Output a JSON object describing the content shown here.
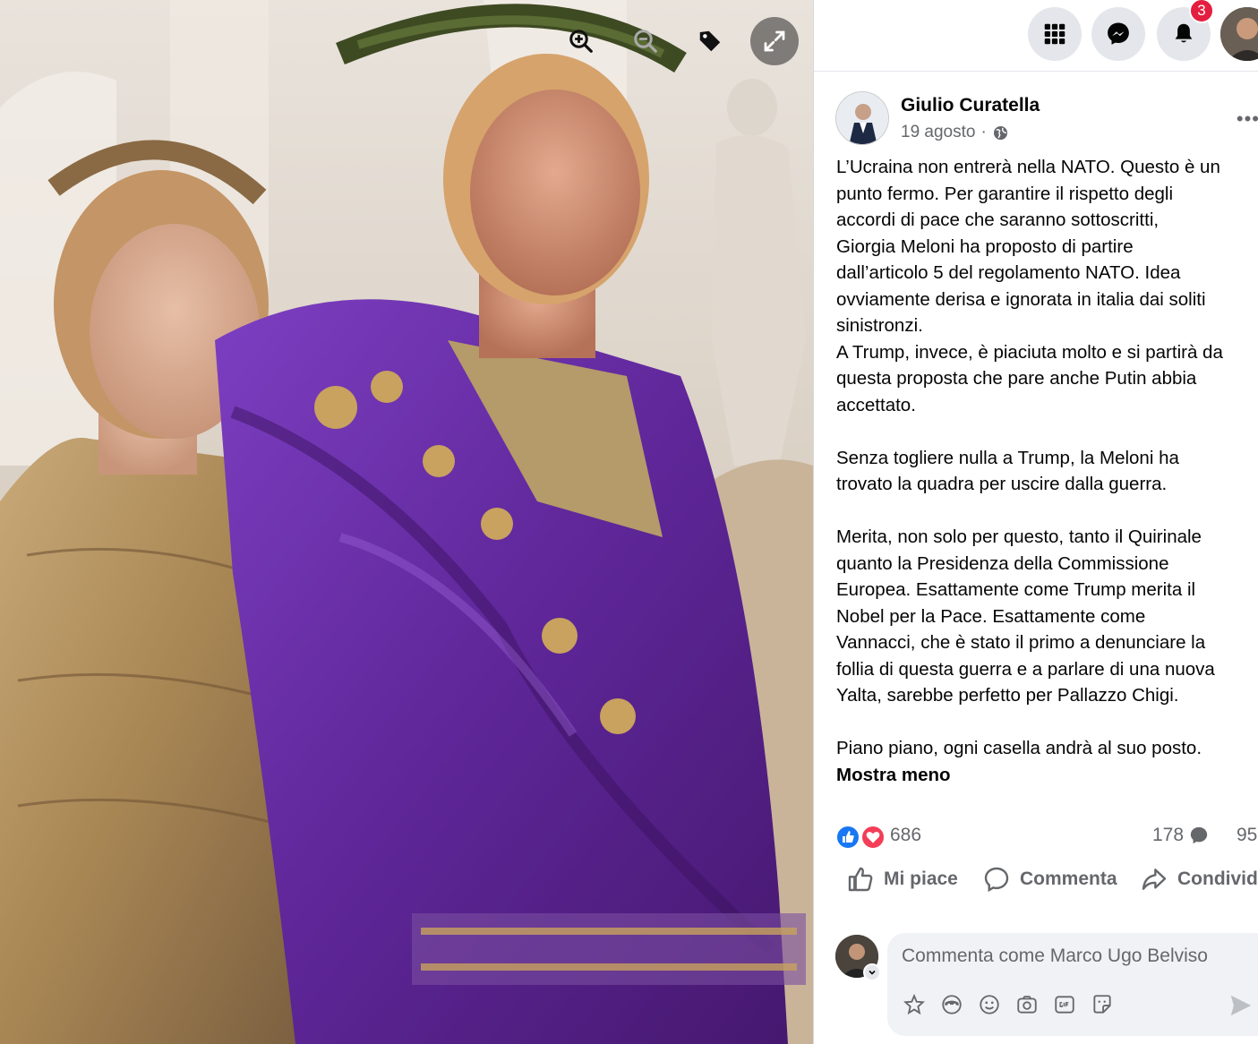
{
  "viewer": {
    "controls": [
      {
        "name": "zoom-in-icon"
      },
      {
        "name": "zoom-out-icon"
      },
      {
        "name": "tag-icon"
      },
      {
        "name": "expand-icon"
      }
    ]
  },
  "topbar": {
    "notifications_badge": "3",
    "icons": [
      "menu-grid-icon",
      "messenger-icon",
      "bell-icon"
    ]
  },
  "post": {
    "author": "Giulio Curatella",
    "date": "19 agosto",
    "date_separator": "·",
    "more": "•••",
    "lines": [
      "L’Ucraina non entrerà nella NATO. Questo è un",
      "punto fermo. Per garantire il rispetto degli",
      "accordi di pace che saranno sottoscritti,",
      "Giorgia Meloni ha proposto di partire",
      "dall’articolo 5 del regolamento NATO. Idea",
      "ovviamente derisa e ignorata in italia dai soliti",
      "sinistronzi.",
      "A Trump, invece, è piaciuta molto e si partirà da",
      "questa proposta che pare anche Putin abbia",
      "accettato.",
      "",
      "Senza togliere nulla a Trump, la Meloni ha",
      "trovato la quadra per uscire dalla guerra.",
      "",
      "Merita, non solo per questo, tanto il Quirinale",
      "quanto la Presidenza della Commissione",
      "Europea. Esattamente come Trump merita il",
      "Nobel per la Pace. Esattamente come",
      "Vannacci, che è stato il primo a denunciare la",
      "follia di questa guerra e a parlare di una nuova",
      "Yalta, sarebbe perfetto per Pallazzo Chigi.",
      "",
      "Piano piano, ogni casella andrà al suo posto."
    ],
    "show_less": "Mostra meno",
    "reaction_count": "686",
    "comment_count": "178",
    "share_count": "95"
  },
  "actions": {
    "like": "Mi piace",
    "comment": "Commenta",
    "share": "Condividi"
  },
  "comment_box": {
    "placeholder": "Commenta come Marco Ugo Belviso"
  },
  "colors": {
    "facebook_blue": "#1877f2",
    "love_red": "#f33e58",
    "badge_red": "#e41e3f",
    "secondary_text": "#65676b",
    "purple_toga": "#6b2fa8"
  }
}
